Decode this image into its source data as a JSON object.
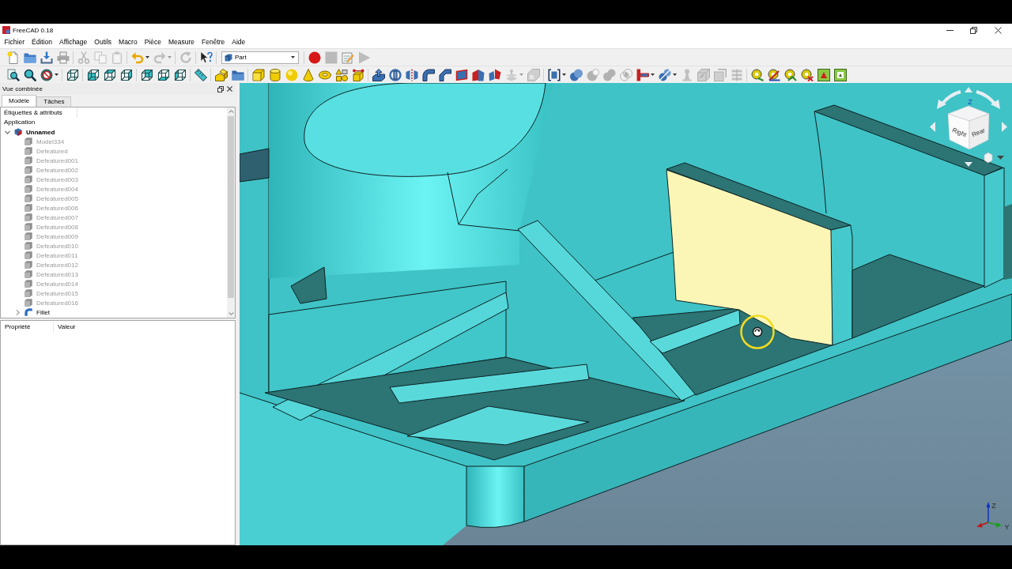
{
  "window": {
    "title": "FreeCAD 0.18"
  },
  "menu": [
    "Fichier",
    "Édition",
    "Affichage",
    "Outils",
    "Macro",
    "Pièce",
    "Measure",
    "Fenêtre",
    "Aide"
  ],
  "toolbars": [
    [
      {
        "buttons": [
          {
            "kind": "new",
            "disabled": false
          },
          {
            "kind": "open",
            "disabled": false
          },
          {
            "kind": "save",
            "disabled": false
          },
          {
            "kind": "print",
            "disabled": false
          }
        ]
      },
      {
        "buttons": [
          {
            "kind": "cut",
            "disabled": true
          },
          {
            "kind": "copy",
            "disabled": true
          },
          {
            "kind": "paste",
            "disabled": true
          }
        ]
      },
      {
        "buttons": [
          {
            "kind": "undo",
            "disabled": false,
            "dropdown": true
          },
          {
            "kind": "redo",
            "disabled": true,
            "dropdown": true
          }
        ]
      },
      {
        "buttons": [
          {
            "kind": "recompute",
            "disabled": true
          }
        ]
      },
      {
        "buttons": [
          {
            "kind": "whats_this",
            "disabled": false
          }
        ]
      },
      {
        "workbench": "Part"
      },
      {
        "buttons": [
          {
            "kind": "macro_record",
            "disabled": false
          },
          {
            "kind": "macro_stop",
            "disabled": true
          },
          {
            "kind": "macro_edit",
            "disabled": false
          },
          {
            "kind": "macro_run",
            "disabled": true
          }
        ]
      }
    ],
    [
      {
        "buttons": [
          {
            "kind": "fit_all",
            "disabled": false
          },
          {
            "kind": "fit_selection",
            "disabled": false
          },
          {
            "kind": "draw_style",
            "disabled": false,
            "dropdown": true
          }
        ]
      },
      {
        "buttons": [
          {
            "kind": "view_iso",
            "disabled": false
          }
        ]
      },
      {
        "buttons": [
          {
            "kind": "view_front",
            "disabled": false
          },
          {
            "kind": "view_top",
            "disabled": false
          },
          {
            "kind": "view_right",
            "disabled": false
          }
        ]
      },
      {
        "buttons": [
          {
            "kind": "view_rear",
            "disabled": false
          },
          {
            "kind": "view_bottom",
            "disabled": false
          },
          {
            "kind": "view_left",
            "disabled": false
          }
        ]
      },
      {
        "buttons": [
          {
            "kind": "measure_distance",
            "disabled": false
          }
        ]
      },
      {
        "buttons": [
          {
            "kind": "part",
            "disabled": false
          },
          {
            "kind": "group",
            "disabled": false
          }
        ]
      },
      {
        "buttons": [
          {
            "kind": "box",
            "disabled": false
          },
          {
            "kind": "cylinder",
            "disabled": false
          },
          {
            "kind": "sphere",
            "disabled": false
          },
          {
            "kind": "cone",
            "disabled": false
          },
          {
            "kind": "torus",
            "disabled": false
          },
          {
            "kind": "primitives",
            "disabled": false
          },
          {
            "kind": "shape_builder",
            "disabled": false
          }
        ]
      },
      {
        "buttons": [
          {
            "kind": "extrude",
            "disabled": false
          },
          {
            "kind": "revolve",
            "disabled": false
          },
          {
            "kind": "mirror",
            "disabled": false
          },
          {
            "kind": "fillet",
            "disabled": false
          },
          {
            "kind": "chamfer",
            "disabled": false
          },
          {
            "kind": "make_face",
            "disabled": false
          },
          {
            "kind": "ruled_surface",
            "disabled": false
          },
          {
            "kind": "loft",
            "disabled": false
          },
          {
            "kind": "offset",
            "disabled": true,
            "dropdown": true
          },
          {
            "kind": "thickness",
            "disabled": true
          }
        ]
      },
      {
        "buttons": [
          {
            "kind": "compound",
            "disabled": false,
            "dropdown": true
          },
          {
            "kind": "boolean",
            "disabled": false
          },
          {
            "kind": "cut_shapes",
            "disabled": true
          },
          {
            "kind": "fuse",
            "disabled": true
          },
          {
            "kind": "common",
            "disabled": true
          },
          {
            "kind": "join",
            "disabled": false,
            "dropdown": true
          },
          {
            "kind": "split",
            "disabled": false,
            "dropdown": true
          },
          {
            "kind": "check_geometry",
            "disabled": true
          },
          {
            "kind": "defeaturing",
            "disabled": true
          },
          {
            "kind": "attachment",
            "disabled": true
          },
          {
            "kind": "cross_sections",
            "disabled": true
          }
        ]
      },
      {
        "buttons": [
          {
            "kind": "measure_linear",
            "disabled": false
          },
          {
            "kind": "measure_angular",
            "disabled": false
          },
          {
            "kind": "measure_refresh",
            "disabled": false
          },
          {
            "kind": "measure_clear",
            "disabled": false
          },
          {
            "kind": "toggle_3d",
            "disabled": false
          },
          {
            "kind": "toggle_delta",
            "disabled": false
          }
        ]
      }
    ]
  ],
  "combo_view": {
    "title": "Vue combinée",
    "tabs": [
      {
        "label": "Modèle",
        "selected": true
      },
      {
        "label": "Tâches",
        "selected": false
      }
    ],
    "tree": {
      "header": "Étiquettes & attributs",
      "root": "Application",
      "items": [
        {
          "label": "Unnamed",
          "kind": "document",
          "expanded": true,
          "children": [
            {
              "label": "Model334",
              "kind": "solid",
              "visible": false
            },
            {
              "label": "Defeatured",
              "kind": "solid",
              "visible": false
            },
            {
              "label": "Defeatured001",
              "kind": "solid",
              "visible": false
            },
            {
              "label": "Defeatured002",
              "kind": "solid",
              "visible": false
            },
            {
              "label": "Defeatured003",
              "kind": "solid",
              "visible": false
            },
            {
              "label": "Defeatured004",
              "kind": "solid",
              "visible": false
            },
            {
              "label": "Defeatured005",
              "kind": "solid",
              "visible": false
            },
            {
              "label": "Defeatured006",
              "kind": "solid",
              "visible": false
            },
            {
              "label": "Defeatured007",
              "kind": "solid",
              "visible": false
            },
            {
              "label": "Defeatured008",
              "kind": "solid",
              "visible": false
            },
            {
              "label": "Defeatured009",
              "kind": "solid",
              "visible": false
            },
            {
              "label": "Defeatured010",
              "kind": "solid",
              "visible": false
            },
            {
              "label": "Defeatured011",
              "kind": "solid",
              "visible": false
            },
            {
              "label": "Defeatured012",
              "kind": "solid",
              "visible": false
            },
            {
              "label": "Defeatured013",
              "kind": "solid",
              "visible": false
            },
            {
              "label": "Defeatured014",
              "kind": "solid",
              "visible": false
            },
            {
              "label": "Defeatured015",
              "kind": "solid",
              "visible": false
            },
            {
              "label": "Defeatured016",
              "kind": "solid",
              "visible": false
            },
            {
              "label": "Fillet",
              "kind": "fillet",
              "visible": true,
              "expanded": false
            }
          ]
        }
      ]
    },
    "properties": {
      "columns": [
        "Propriété",
        "Valeur"
      ]
    }
  },
  "view_3d": {
    "navigation_cube": {
      "faces": [
        "Right",
        "Rear"
      ],
      "axis_label": "Z"
    },
    "axis_cross": {
      "labels": [
        "Z",
        "Y"
      ]
    }
  }
}
